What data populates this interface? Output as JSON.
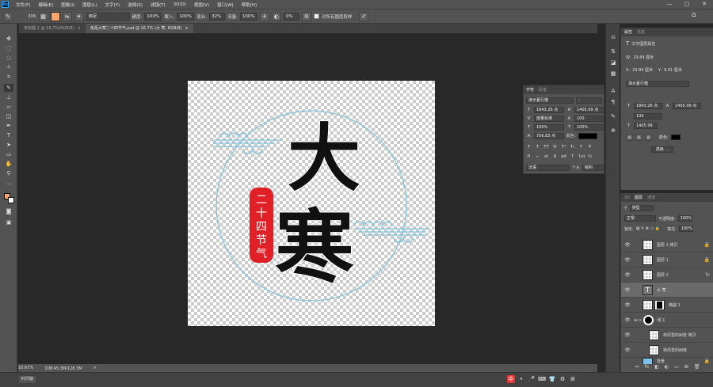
{
  "app": {
    "logo": "Ps",
    "menu": [
      "文件(F)",
      "编辑(E)",
      "图像(I)",
      "图层(L)",
      "文字(Y)",
      "选择(S)",
      "滤镜(T)",
      "3D(D)",
      "视图(V)",
      "窗口(W)",
      "帮助(H)"
    ],
    "window_controls": [
      "—",
      "▢",
      "✕"
    ]
  },
  "options": {
    "brush_size": "306",
    "mode_value": "自定",
    "opacity_label": "硬度:",
    "opacity_value": "100%",
    "flow_label": "载入:",
    "flow_value": "100%",
    "mix_label": "混合:",
    "mix_value": "32%",
    "rate_label": "流量:",
    "rate_value": "100%",
    "angle_value": "0%",
    "sample_label": "对所有图层取样"
  },
  "tabs": [
    {
      "label": "未标题-1 @ 16.7%(RGB/8)",
      "close": "×",
      "active": false
    },
    {
      "label": "免抠大寒二十四节气.psd @ 16.7% (大 寒, RGB/8)",
      "close": "×",
      "active": true
    }
  ],
  "status": {
    "zoom": "16.67%",
    "doc_info": "文档:45.3M/128.3M",
    "arrow": ">"
  },
  "timeline": {
    "label": "时间轴"
  },
  "artwork": {
    "big_char_1": "大",
    "big_char_2": "寒",
    "seal_text": [
      "二",
      "十",
      "四",
      "节",
      "气"
    ],
    "colors": {
      "ring": "#7fc1dc",
      "cloud": "#7fc1dc",
      "seal": "#e01f26",
      "ink": "#111111"
    }
  },
  "character_panel": {
    "tabs": [
      "字符",
      "段落"
    ],
    "font": "演示夏行楷",
    "font_style": "-",
    "size": "1843.26 点",
    "leading": "1405.99 点",
    "kerning": "度量标准",
    "tracking": "100",
    "vscale": "100%",
    "hscale": "100%",
    "baseline": "756.83 点",
    "color_label": "颜色:",
    "styles": [
      "T",
      "T",
      "TT",
      "Tr",
      "T¹",
      "T₁",
      "T",
      "Ŧ"
    ],
    "ot": [
      "fi",
      "ℴ",
      "st",
      "A",
      "ad",
      "T",
      "1st",
      "½"
    ],
    "lang": "法语",
    "aa_symbol": "ª a",
    "aa": "锐利"
  },
  "properties": {
    "tabs": [
      "属性",
      "信息"
    ],
    "subtitle": "文字图层属性",
    "w_label": "W:",
    "w_value": "29.84 厘米",
    "x_label": "X:",
    "x_value": "29.84 厘米",
    "y_label": "Y:",
    "y_value": "9.91 厘米",
    "font": "演示夏行楷",
    "size": "1843.26 点",
    "leading": "1405.99 点",
    "tracking": "100",
    "vscale": "1405.99",
    "color_label": "颜色:",
    "more": "高级 ..."
  },
  "layers_panel": {
    "tabs": [
      "3D",
      "图层",
      "通道"
    ],
    "filter": "类型",
    "blend": "正常",
    "opacity_label": "不透明度:",
    "opacity_value": "100%",
    "lock_label": "锁定:",
    "fill_label": "填充:",
    "fill_value": "100%",
    "layers": [
      {
        "name": "图层 1 拷贝",
        "badge": "🔒"
      },
      {
        "name": "图层 1",
        "badge": "🔒"
      },
      {
        "name": "图层 2",
        "badge": "fx"
      },
      {
        "name": "大 寒",
        "badge": ""
      },
      {
        "name": "椭圆 1",
        "badge": ""
      },
      {
        "name": "组 1",
        "badge": ""
      },
      {
        "name": "荷风雪的树枝 拷贝",
        "badge": ""
      },
      {
        "name": "荷风雪的树枝",
        "badge": ""
      },
      {
        "name": "背景",
        "badge": "🔒"
      }
    ],
    "footer": [
      "⇔",
      "fx",
      "◧",
      "◐",
      "▭",
      "⊞",
      "🗑"
    ]
  },
  "tray": [
    "中",
    "•",
    "🎤",
    "⌨",
    "👕",
    "⚙",
    "⊞"
  ]
}
